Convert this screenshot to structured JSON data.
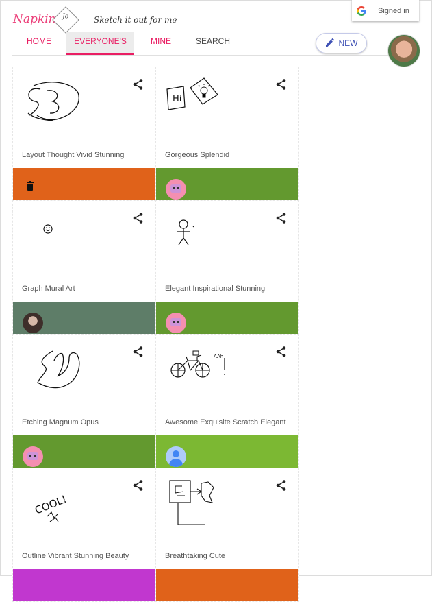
{
  "header": {
    "brand": "Napkin",
    "logo_mark": "Jo",
    "tagline": "Sketch it out for me",
    "signin_label": "Signed in",
    "new_label": "NEW"
  },
  "nav": {
    "tabs": [
      {
        "label": "HOME"
      },
      {
        "label": "EVERYONE'S"
      },
      {
        "label": "MINE"
      },
      {
        "label": "SEARCH"
      }
    ]
  },
  "cards": [
    {
      "title": "Layout Thought Vivid Stunning",
      "bar_color": "#e0621a",
      "owner": "delete-icon"
    },
    {
      "title": "Gorgeous Splendid",
      "bar_color": "#63992f",
      "owner": "robot-avatar"
    },
    {
      "title": "Graph Mural Art",
      "bar_color": "#5e7d68",
      "owner": "photo-avatar"
    },
    {
      "title": "Elegant Inspirational Stunning",
      "bar_color": "#63992f",
      "owner": "robot-avatar"
    },
    {
      "title": "Etching Magnum Opus",
      "bar_color": "#63992f",
      "owner": "robot-avatar"
    },
    {
      "title": "Awesome Exquisite Scratch Elegant",
      "bar_color": "#7cb833",
      "owner": "user-avatar"
    },
    {
      "title": "Outline Vibrant Stunning Beauty",
      "bar_color": "#c137cf",
      "owner": "none"
    },
    {
      "title": "Breathtaking Cute",
      "bar_color": "#e0621a",
      "owner": "none"
    }
  ],
  "sketch_text": {
    "card2": "Hi",
    "card6": "AAh",
    "card7": "COOL!"
  },
  "colors": {
    "brand": "#ec407a",
    "tab_active": "#e91e63",
    "new_button": "#3f51b5"
  }
}
